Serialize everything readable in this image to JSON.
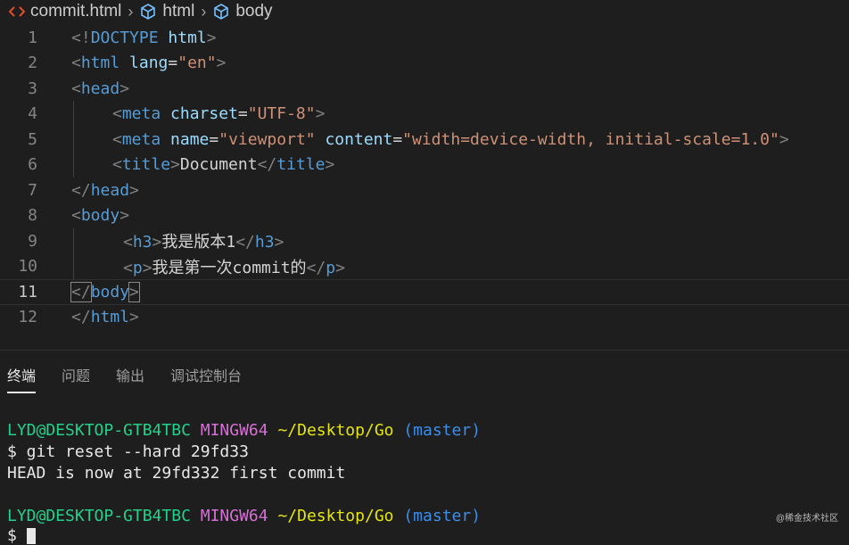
{
  "breadcrumb": {
    "file": "commit.html",
    "items": [
      "html",
      "body"
    ]
  },
  "editor": {
    "lines": [
      {
        "n": "1",
        "tokens": [
          [
            "br",
            "<!"
          ],
          [
            "kw",
            "DOCTYPE"
          ],
          [
            "txt",
            " "
          ],
          [
            "attr",
            "html"
          ],
          [
            "br",
            ">"
          ]
        ],
        "indent": 0
      },
      {
        "n": "2",
        "tokens": [
          [
            "br",
            "<"
          ],
          [
            "tag",
            "html"
          ],
          [
            "txt",
            " "
          ],
          [
            "attr",
            "lang"
          ],
          [
            "txt",
            "="
          ],
          [
            "str",
            "\"en\""
          ],
          [
            "br",
            ">"
          ]
        ],
        "indent": 0
      },
      {
        "n": "3",
        "tokens": [
          [
            "br",
            "<"
          ],
          [
            "tag",
            "head"
          ],
          [
            "br",
            ">"
          ]
        ],
        "indent": 0
      },
      {
        "n": "4",
        "tokens": [
          [
            "br",
            "<"
          ],
          [
            "tag",
            "meta"
          ],
          [
            "txt",
            " "
          ],
          [
            "attr",
            "charset"
          ],
          [
            "txt",
            "="
          ],
          [
            "str",
            "\"UTF-8\""
          ],
          [
            "br",
            ">"
          ]
        ],
        "indent": 1
      },
      {
        "n": "5",
        "tokens": [
          [
            "br",
            "<"
          ],
          [
            "tag",
            "meta"
          ],
          [
            "txt",
            " "
          ],
          [
            "attr",
            "name"
          ],
          [
            "txt",
            "="
          ],
          [
            "str",
            "\"viewport\""
          ],
          [
            "txt",
            " "
          ],
          [
            "attr",
            "content"
          ],
          [
            "txt",
            "="
          ],
          [
            "str",
            "\"width=device-width, initial-scale=1.0\""
          ],
          [
            "br",
            ">"
          ]
        ],
        "indent": 1
      },
      {
        "n": "6",
        "tokens": [
          [
            "br",
            "<"
          ],
          [
            "tag",
            "title"
          ],
          [
            "br",
            ">"
          ],
          [
            "txt",
            "Document"
          ],
          [
            "br",
            "</"
          ],
          [
            "tag",
            "title"
          ],
          [
            "br",
            ">"
          ]
        ],
        "indent": 1
      },
      {
        "n": "7",
        "tokens": [
          [
            "br",
            "</"
          ],
          [
            "tag",
            "head"
          ],
          [
            "br",
            ">"
          ]
        ],
        "indent": 0
      },
      {
        "n": "8",
        "tokens": [
          [
            "br",
            "<"
          ],
          [
            "tag",
            "body"
          ],
          [
            "br",
            ">"
          ]
        ],
        "indent": 0
      },
      {
        "n": "9",
        "tokens": [
          [
            "br",
            "<"
          ],
          [
            "tag",
            "h3"
          ],
          [
            "br",
            ">"
          ],
          [
            "txt",
            "我是版本1"
          ],
          [
            "br",
            "</"
          ],
          [
            "tag",
            "h3"
          ],
          [
            "br",
            ">"
          ]
        ],
        "indent": 2
      },
      {
        "n": "10",
        "tokens": [
          [
            "br",
            "<"
          ],
          [
            "tag",
            "p"
          ],
          [
            "br",
            ">"
          ],
          [
            "txt",
            "我是第一次commit的"
          ],
          [
            "br",
            "</"
          ],
          [
            "tag",
            "p"
          ],
          [
            "br",
            ">"
          ]
        ],
        "indent": 2
      },
      {
        "n": "11",
        "tokens": [
          [
            "br",
            "</"
          ],
          [
            "tag",
            "body"
          ],
          [
            "br",
            ">"
          ]
        ],
        "indent": 0,
        "active": true
      },
      {
        "n": "12",
        "tokens": [
          [
            "br",
            "</"
          ],
          [
            "tag",
            "html"
          ],
          [
            "br",
            ">"
          ]
        ],
        "indent": 0
      }
    ]
  },
  "panel": {
    "tabs": [
      "终端",
      "问题",
      "输出",
      "调试控制台"
    ],
    "active_tab": "终端"
  },
  "terminal": {
    "prompt1": {
      "user": "LYD@DESKTOP-GTB4TBC",
      "env": "MINGW64",
      "path": "~/Desktop/Go",
      "branch": "(master)"
    },
    "command": "$ git reset --hard 29fd33",
    "output": "HEAD is now at 29fd332 first commit",
    "prompt2": {
      "user": "LYD@DESKTOP-GTB4TBC",
      "env": "MINGW64",
      "path": "~/Desktop/Go",
      "branch": "(master)"
    },
    "input_prefix": "$"
  },
  "watermark": "@稀金技术社区",
  "colors": {
    "background": "#1e1e1e",
    "tag": "#569cd6",
    "attr": "#9cdcfe",
    "string": "#ce9178",
    "term_green": "#23d18b",
    "term_magenta": "#d670d6",
    "term_yellow": "#e5e510",
    "term_blue": "#3b8eea"
  }
}
